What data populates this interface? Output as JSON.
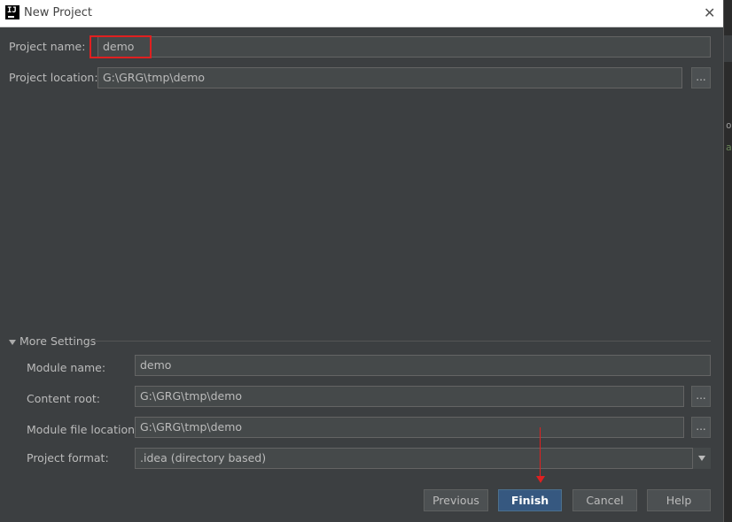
{
  "window": {
    "title": "New Project",
    "app_icon_text": "IJ"
  },
  "right_strip_chars": [
    "o",
    "a"
  ],
  "project_name": {
    "label": "Project name:",
    "value": "demo"
  },
  "project_location": {
    "label": "Project location:",
    "value": "G:\\GRG\\tmp\\demo",
    "browse": "..."
  },
  "more_settings": {
    "title": "More Settings",
    "module_name": {
      "label": "Module name:",
      "value": "demo"
    },
    "content_root": {
      "label": "Content root:",
      "value": "G:\\GRG\\tmp\\demo",
      "browse": "..."
    },
    "module_file_location": {
      "label": "Module file location:",
      "value": "G:\\GRG\\tmp\\demo",
      "browse": "..."
    },
    "project_format": {
      "label": "Project format:",
      "value": ".idea (directory based)"
    }
  },
  "buttons": {
    "previous": "Previous",
    "finish": "Finish",
    "cancel": "Cancel",
    "help": "Help"
  },
  "colors": {
    "background": "#3c3f41",
    "default_button": "#365880",
    "annotation": "#e02020"
  }
}
